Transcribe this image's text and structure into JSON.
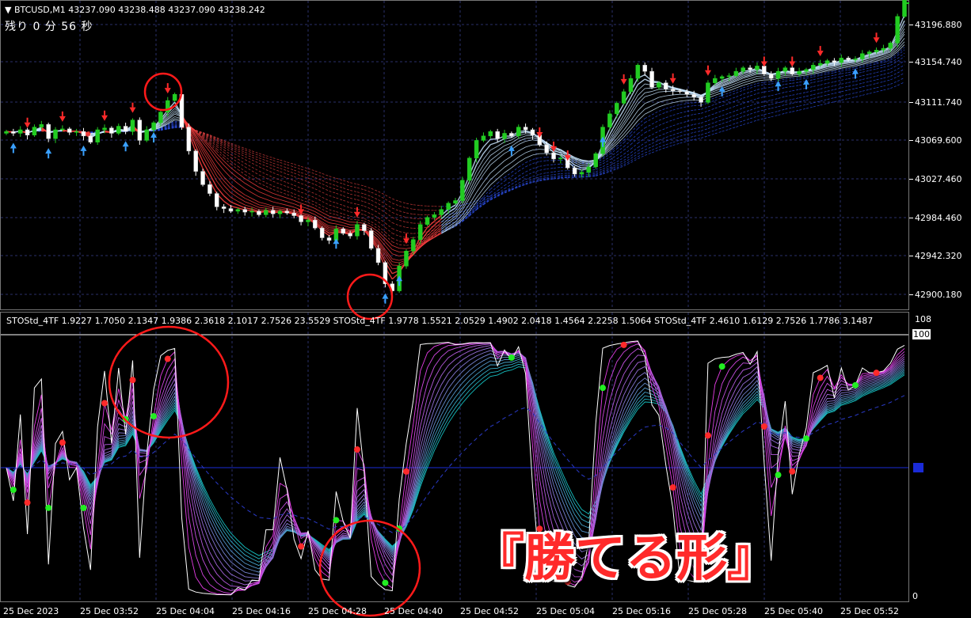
{
  "header": {
    "symbol": "BTCUSD,M1",
    "ohlc": "43237.090 43238.488 43237.090 43238.242",
    "countdown": "残り 0 分 56 秒"
  },
  "indicator": {
    "label": "STOStd_4TF 1.9227 1.7050 2.1347 1.9386 2.3618 2.1017 2.7526 23.5529  STOStd_4TF 1.9778 1.5521 2.0529 1.4902 2.0418 1.4564 2.2258 1.5064  STOStd_4TF 2.4610 1.6129 2.7526 1.7786 3.1487",
    "scale_top": "108",
    "scale_100": "100",
    "scale_0": "0"
  },
  "price_axis": [
    "43196.880",
    "43154.740",
    "43111.740",
    "43069.600",
    "43027.460",
    "42984.460",
    "42942.320",
    "42900.180"
  ],
  "time_axis": [
    "25 Dec 2023",
    "25 Dec 03:52",
    "25 Dec 04:04",
    "25 Dec 04:16",
    "25 Dec 04:28",
    "25 Dec 04:40",
    "25 Dec 04:52",
    "25 Dec 05:04",
    "25 Dec 05:16",
    "25 Dec 05:28",
    "25 Dec 05:40",
    "25 Dec 05:52"
  ],
  "annotation": "『勝てる形』",
  "colors": {
    "background": "#000000",
    "bull_candle": "#22cc22",
    "bear_candle": "#ffffff",
    "sell_arrow": "#ff2a2a",
    "buy_arrow": "#3aa0ff",
    "circle": "#ff1a1a",
    "level_line": "#1a2bd8"
  },
  "chart_data": {
    "type": "candlestick",
    "symbol": "BTCUSD",
    "timeframe": "M1",
    "ylim": [
      42880,
      43225
    ],
    "close": [
      43080,
      43078,
      43082,
      43076,
      43085,
      43088,
      43072,
      43082,
      43083,
      43079,
      43080,
      43075,
      43068,
      43082,
      43084,
      43078,
      43086,
      43080,
      43093,
      43070,
      43082,
      43090,
      43102,
      43115,
      43122,
      43085,
      43058,
      43035,
      43020,
      43010,
      42995,
      42993,
      42990,
      42992,
      42989,
      42990,
      42986,
      42991,
      42987,
      42990,
      42988,
      42985,
      42978,
      42980,
      42971,
      42960,
      42957,
      42970,
      42965,
      42962,
      42975,
      42968,
      42948,
      42932,
      42908,
      42900,
      42928,
      42945,
      42958,
      42975,
      42983,
      42986,
      42992,
      42999,
      43002,
      43025,
      43050,
      43070,
      43075,
      43080,
      43072,
      43078,
      43075,
      43085,
      43082,
      43076,
      43065,
      43056,
      43049,
      43050,
      43039,
      43032,
      43034,
      43040,
      43055,
      43085,
      43100,
      43112,
      43125,
      43140,
      43155,
      43148,
      43130,
      43135,
      43128,
      43126,
      43125,
      43122,
      43119,
      43113,
      43135,
      43140,
      43142,
      43143,
      43148,
      43152,
      43150,
      43154,
      43145,
      43140,
      43148,
      43152,
      43145,
      43148,
      43150,
      43155,
      43157,
      43160,
      43158,
      43163,
      43161,
      43162,
      43168,
      43170,
      43172,
      43174,
      43180,
      43210,
      43230
    ],
    "indicator": {
      "name": "STOStd_4TF",
      "ylim": [
        0,
        108
      ],
      "levels": [
        0,
        50,
        100
      ]
    }
  }
}
